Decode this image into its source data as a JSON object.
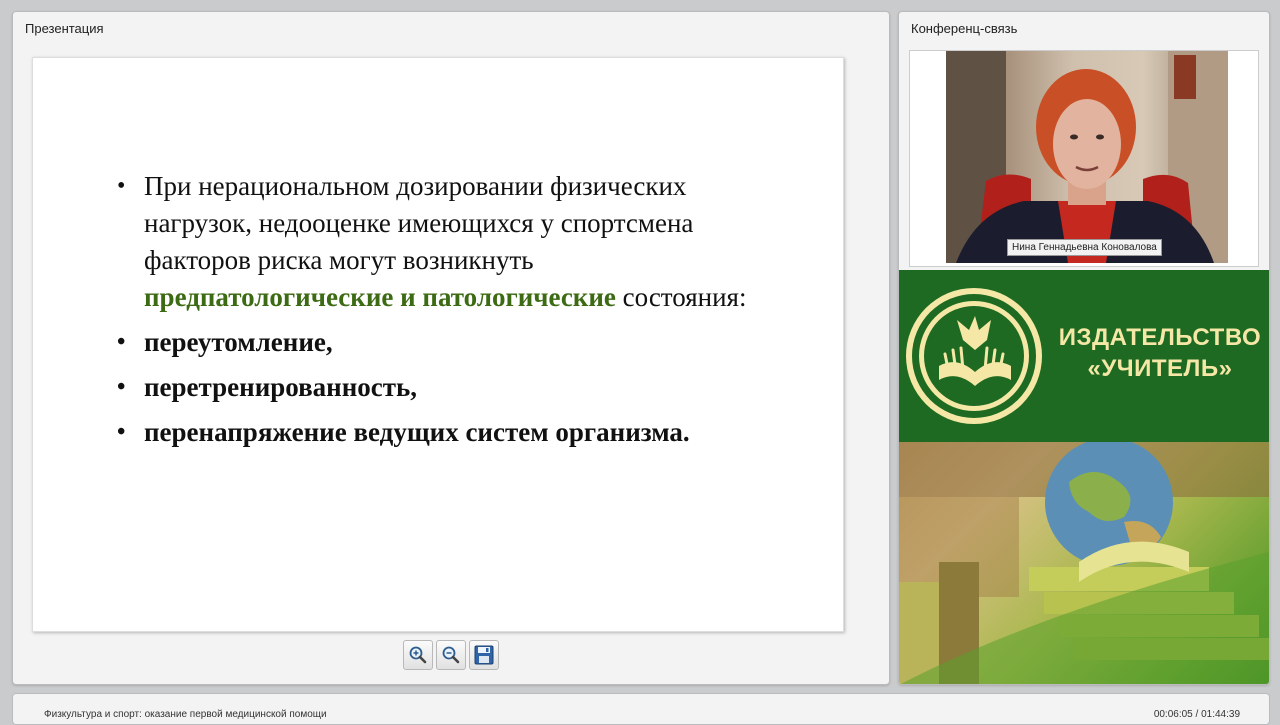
{
  "presentation": {
    "panel_title": "Презентация",
    "slide": {
      "intro": {
        "part1": "При нерациональном дозировании физических нагрузок, недооценке имеющихся у спортсмена факторов риска могут возникнуть ",
        "highlight": "предпатологические и патологические",
        "part2": " состояния:"
      },
      "bullets": [
        "переутомление,",
        "перетренированность,",
        "перенапряжение ведущих систем организма."
      ]
    },
    "toolbar": {
      "zoom_in_icon": "zoom-in-icon",
      "zoom_out_icon": "zoom-out-icon",
      "save_icon": "save-icon"
    }
  },
  "conference": {
    "panel_title": "Конференц-связь",
    "speaker_name": "Нина Геннадьевна Коновалова"
  },
  "publisher": {
    "line1": "ИЗДАТЕЛЬСТВО",
    "line2": "«УЧИТЕЛЬ»"
  },
  "status": {
    "title": "Физкультура и спорт: оказание первой медицинской помощи",
    "time": "00:06:05 / 01:44:39"
  },
  "colors": {
    "accent_green": "#3d6b14",
    "logo_bg": "#1e6a22",
    "logo_text": "#f5e8a6"
  }
}
